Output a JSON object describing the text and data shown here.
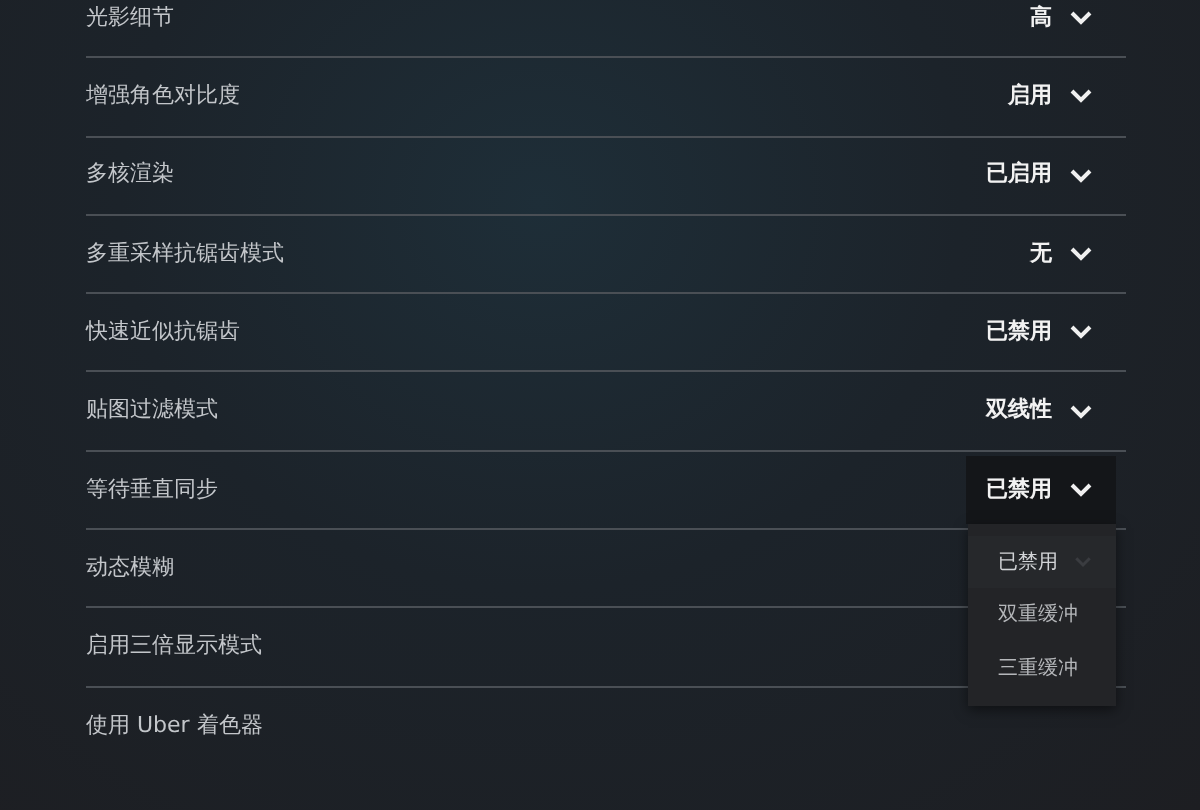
{
  "settings": [
    {
      "label": "光影细节",
      "value": "高",
      "open": false
    },
    {
      "label": "增强角色对比度",
      "value": "启用",
      "open": false
    },
    {
      "label": "多核渲染",
      "value": "已启用",
      "open": false
    },
    {
      "label": "多重采样抗锯齿模式",
      "value": "无",
      "open": false
    },
    {
      "label": "快速近似抗锯齿",
      "value": "已禁用",
      "open": false
    },
    {
      "label": "贴图过滤模式",
      "value": "双线性",
      "open": false
    },
    {
      "label": "等待垂直同步",
      "value": "已禁用",
      "open": true,
      "options": [
        {
          "label": "已禁用",
          "selected": true
        },
        {
          "label": "双重缓冲",
          "selected": false
        },
        {
          "label": "三重缓冲",
          "selected": false
        }
      ]
    },
    {
      "label": "动态模糊"
    },
    {
      "label": "启用三倍显示模式"
    },
    {
      "label": "使用 Uber 着色器"
    }
  ]
}
